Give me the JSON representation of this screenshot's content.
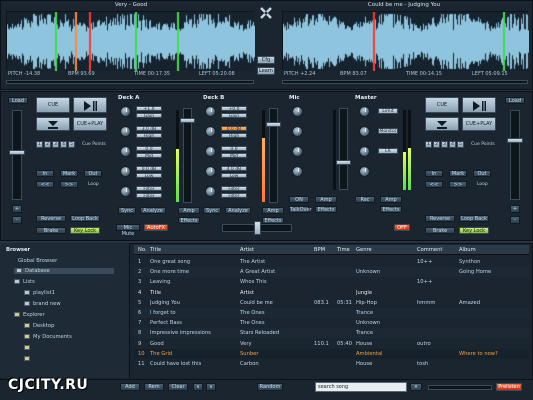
{
  "deckA": {
    "title": "Very - Good",
    "pitch": "PITCH -14.38",
    "bpm": "BPM 93.69",
    "time": "TIME 00:17.35",
    "left": "LEFT 05:20.08"
  },
  "deckB": {
    "title": "Could be me - Judging You",
    "pitch": "PITCH +2.24",
    "bpm": "BPM 83.07",
    "time": "TIME 00:14.15",
    "left": "LEFT 05:09.15"
  },
  "center": {
    "cfg": "Cfg",
    "learn": "Learn"
  },
  "transport": {
    "load": "Load",
    "cue": "CUE",
    "cue_play": "CUE+PLAY",
    "pitch_bend_minus": "-",
    "pitch_bend_plus": "+",
    "hot_cues": [
      "1",
      "2",
      "3",
      "4",
      "5"
    ],
    "cue_points": "Cue Points",
    "in": "In",
    "mark": "Mark",
    "out": "Out",
    "rew": "<<",
    "ffw": ">>",
    "loop": "Loop",
    "reverse": "Reverse",
    "loop_back": "Loop Back",
    "brake": "Brake",
    "key_lock": "Key Lock",
    "mic_mute": "Mic Mute",
    "autofx": "AutoFX"
  },
  "sections": {
    "deckA": "Deck A",
    "deckB": "Deck B",
    "mic": "Mic",
    "master": "Master"
  },
  "eq": {
    "gain": "Gain",
    "high": "High",
    "mid": "Mid",
    "low": "Low",
    "filter": "Filter",
    "sync": "Sync",
    "analyze": "Analyze",
    "amp": "Amp",
    "fx": "FX",
    "effects": "Effects",
    "on": "ON",
    "off": "OFF",
    "limit": "Limit",
    "monitor": "Monitor",
    "lr_swap": "LR Swap",
    "record": "Rec",
    "talkover": "TalkOver"
  },
  "deckA_values": {
    "gain": "+1.0",
    "high": "3.0 dB",
    "mid": "0.0",
    "low": "0.0 dB",
    "filter": "Filter"
  },
  "deckB_values": {
    "gain": "+0.0",
    "high": "0.0 dB",
    "mid": "0.0",
    "low": "4.0 dB",
    "filter": "Filter"
  },
  "browser": {
    "title": "Browser",
    "global": "Global Browser",
    "database": "Database",
    "lists": "Lists",
    "playlist1": "playlist1",
    "brand_new": "brand new",
    "explorer": "Explorer",
    "desktop": "Desktop",
    "my_documents": "My Documents"
  },
  "table": {
    "headers": {
      "no": "No.",
      "title": "Title",
      "artist": "Artist",
      "bpm": "BPM",
      "time": "Time",
      "genre": "Genre",
      "comment": "Comment",
      "album": "Album"
    },
    "rows": [
      {
        "no": "1",
        "title": "One great song",
        "artist": "The Artist",
        "bpm": "",
        "time": "",
        "genre": "",
        "comment": "10++",
        "album": "Synthon",
        "cls": ""
      },
      {
        "no": "2",
        "title": "One more time",
        "artist": "A Great Artist",
        "bpm": "",
        "time": "",
        "genre": "Unknown",
        "comment": "",
        "album": "Going Home",
        "cls": "alt"
      },
      {
        "no": "3",
        "title": "Leaving",
        "artist": "Whos This",
        "bpm": "",
        "time": "",
        "genre": "",
        "comment": "10++",
        "album": "",
        "cls": ""
      },
      {
        "no": "4",
        "title": "Title",
        "artist": "Artist",
        "bpm": "",
        "time": "",
        "genre": "Jungle",
        "comment": "",
        "album": "",
        "cls": "grp"
      },
      {
        "no": "5",
        "title": "Judging You",
        "artist": "Could be me",
        "bpm": "083.1",
        "time": "05:31",
        "genre": "Hip-Hop",
        "comment": "hmmm",
        "album": "Amazed",
        "cls": ""
      },
      {
        "no": "6",
        "title": "I forget to",
        "artist": "The Ones",
        "bpm": "",
        "time": "",
        "genre": "Trance",
        "comment": "",
        "album": "",
        "cls": "alt"
      },
      {
        "no": "7",
        "title": "Perfect Bass",
        "artist": "The Ones",
        "bpm": "",
        "time": "",
        "genre": "Unknown",
        "comment": "",
        "album": "",
        "cls": ""
      },
      {
        "no": "8",
        "title": "Impressive impressions",
        "artist": "Stars Reloaded",
        "bpm": "",
        "time": "",
        "genre": "Trance",
        "comment": "",
        "album": "",
        "cls": "alt"
      },
      {
        "no": "9",
        "title": "Good",
        "artist": "Very",
        "bpm": "110.1",
        "time": "05:40",
        "genre": "House",
        "comment": "outro",
        "album": "",
        "cls": ""
      },
      {
        "no": "10",
        "title": "The Grid",
        "artist": "Sunber",
        "bpm": "",
        "time": "",
        "genre": "Ambiental",
        "comment": "",
        "album": "Where to now?",
        "cls": "sel"
      },
      {
        "no": "11",
        "title": "Could have lost this",
        "artist": "Carbon",
        "bpm": "",
        "time": "",
        "genre": "House",
        "comment": "tosh",
        "album": "",
        "cls": ""
      }
    ]
  },
  "bottombar": {
    "add": "Add",
    "rem": "Rem",
    "clear": "Clear",
    "up": "∧",
    "down": "∨",
    "random": "Random",
    "search_value": "search song",
    "prelisten": "Prelisten"
  },
  "watermark": "CJCITY.RU",
  "colors": {
    "accent": "#ffa23a",
    "wave": "#8ec4de",
    "cue_green": "#3ee04a",
    "cue_orange": "#ff8a3a",
    "cue_red": "#ff3a2a"
  }
}
